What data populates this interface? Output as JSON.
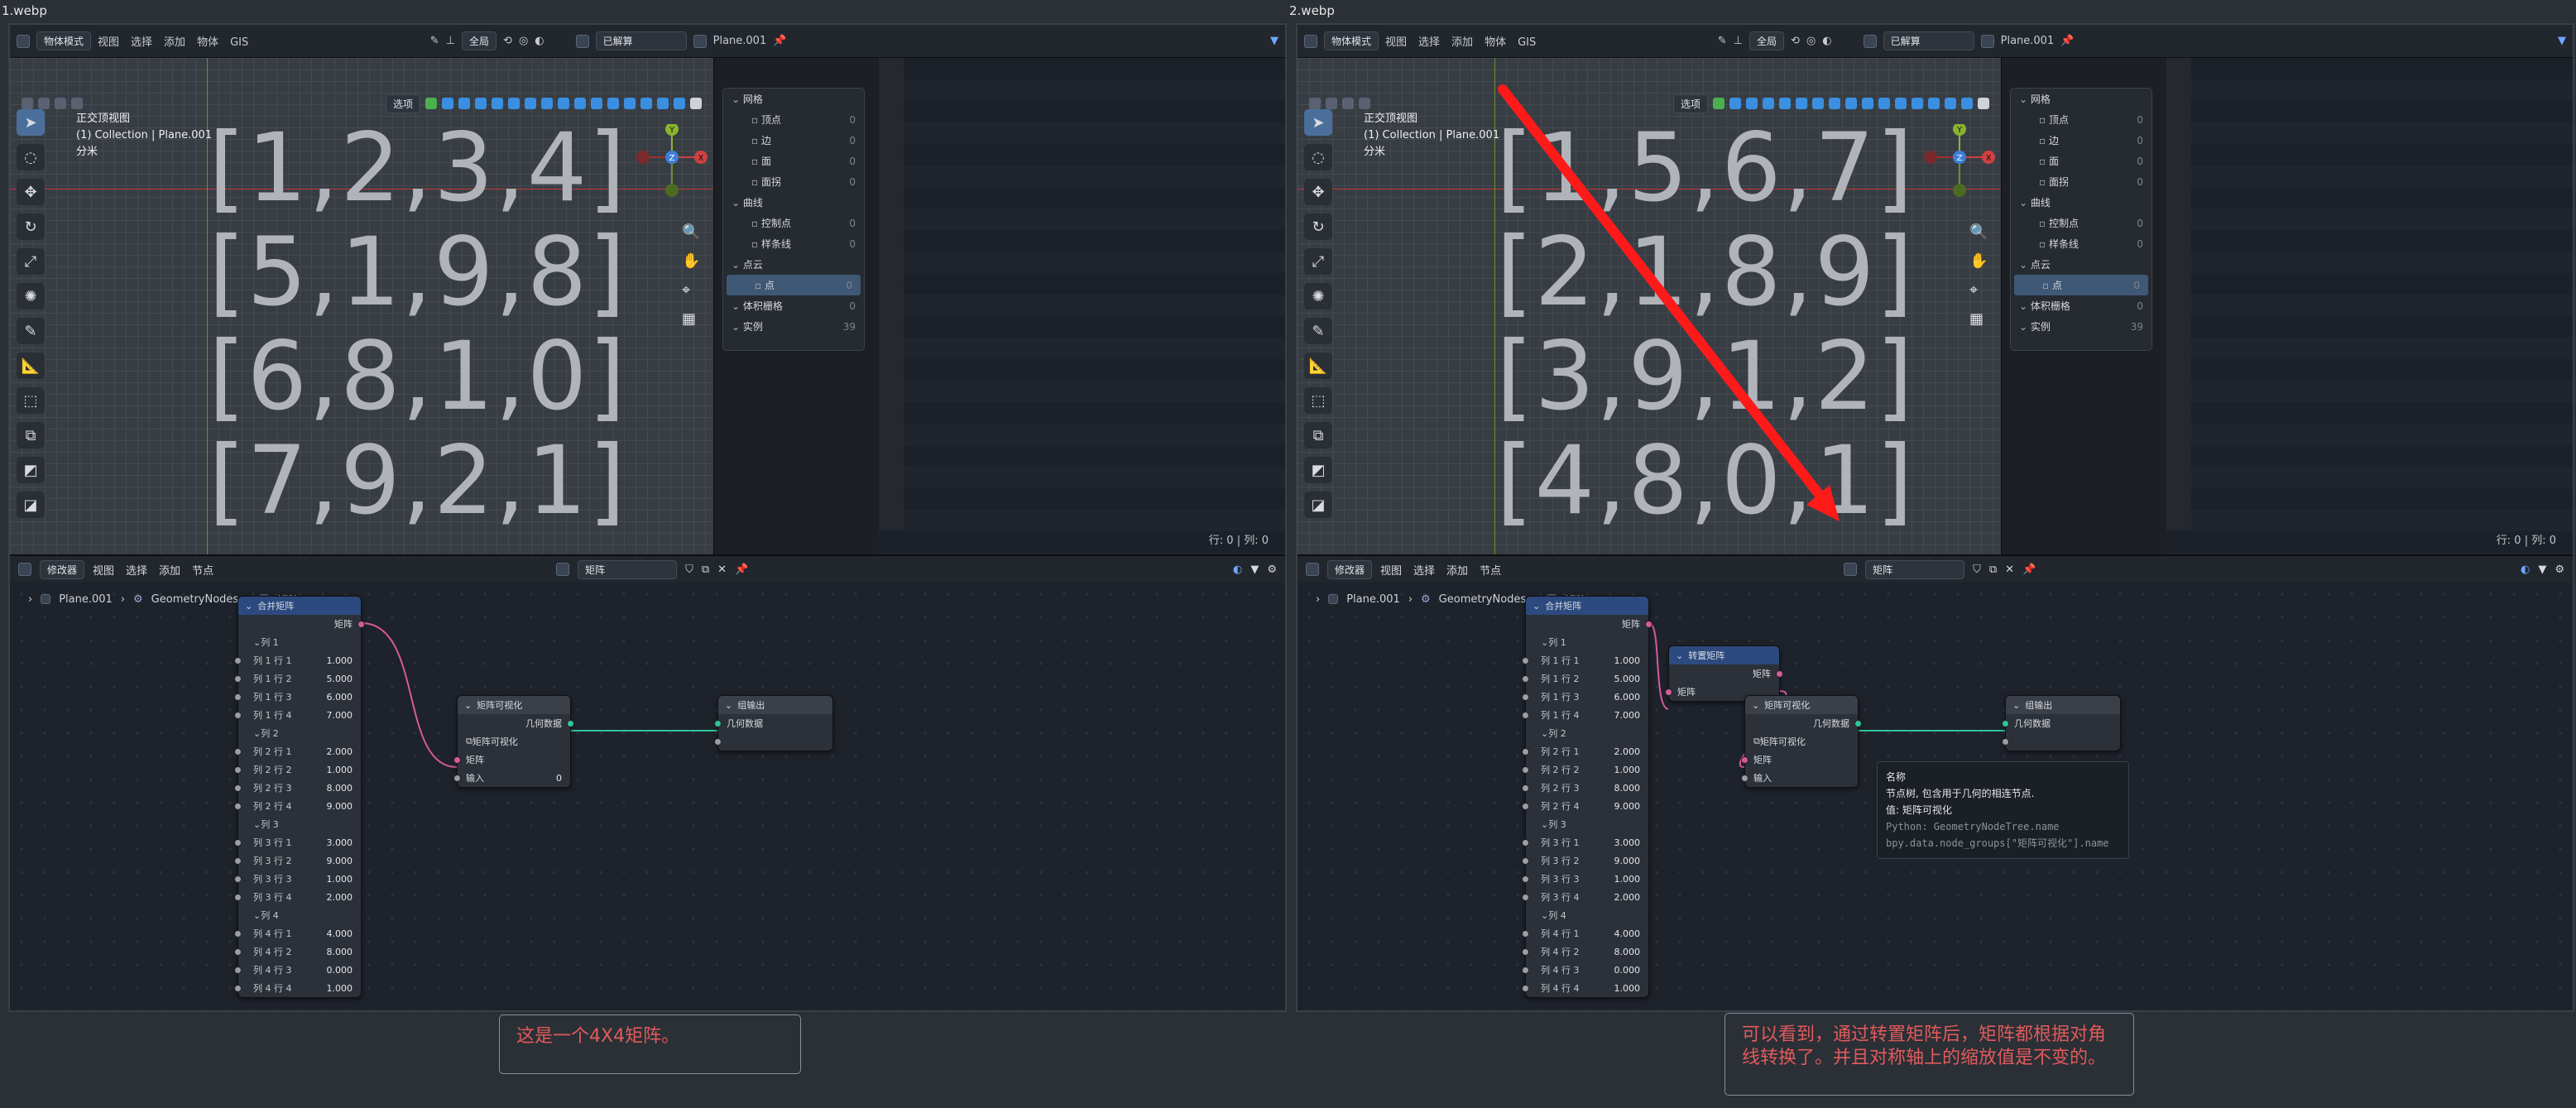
{
  "windows": [
    {
      "filename": "1.webp",
      "header": {
        "mode": "物体模式",
        "menus": [
          "视图",
          "选择",
          "添加",
          "物体",
          "GIS"
        ],
        "global": "全局",
        "evaluated": "已解算",
        "object": "Plane.001"
      },
      "overlay_options": "选项",
      "view_info": [
        "正交顶视图",
        "(1) Collection | Plane.001",
        "分米"
      ],
      "matrix": [
        "[1,2,3,4]",
        "[5,1,9,8]",
        "[6,8,1,0]",
        "[7,9,2,1]"
      ],
      "gizmo": {
        "x": "X",
        "y": "Y",
        "z": "Z"
      },
      "sidebar": {
        "items": [
          {
            "label": "网格",
            "value": "",
            "level": 0
          },
          {
            "label": "顶点",
            "value": "0",
            "level": 1
          },
          {
            "label": "边",
            "value": "0",
            "level": 1
          },
          {
            "label": "面",
            "value": "0",
            "level": 1
          },
          {
            "label": "面拐",
            "value": "0",
            "level": 1
          },
          {
            "label": "曲线",
            "value": "",
            "level": 0
          },
          {
            "label": "控制点",
            "value": "0",
            "level": 1
          },
          {
            "label": "样条线",
            "value": "0",
            "level": 1
          },
          {
            "label": "点云",
            "value": "",
            "level": 0
          },
          {
            "label": "点",
            "value": "0",
            "level": 1,
            "selected": true
          },
          {
            "label": "体积栅格",
            "value": "0",
            "level": 0
          },
          {
            "label": "实例",
            "value": "39",
            "level": 0
          }
        ]
      },
      "rowcol": "行: 0  |  列: 0",
      "node_header": {
        "editor": "修改器",
        "menus": [
          "视图",
          "选择",
          "添加",
          "节点"
        ],
        "tree": "矩阵"
      },
      "breadcrumb": [
        "Plane.001",
        "GeometryNodes",
        "矩阵"
      ],
      "combine": {
        "title": "合并矩阵",
        "output": "矩阵",
        "columns": [
          {
            "label": "列 1",
            "rows": [
              [
                "列 1 行 1",
                "1.000"
              ],
              [
                "列 1 行 2",
                "5.000"
              ],
              [
                "列 1 行 3",
                "6.000"
              ],
              [
                "列 1 行 4",
                "7.000"
              ]
            ]
          },
          {
            "label": "列 2",
            "rows": [
              [
                "列 2 行 1",
                "2.000"
              ],
              [
                "列 2 行 2",
                "1.000"
              ],
              [
                "列 2 行 3",
                "8.000"
              ],
              [
                "列 2 行 4",
                "9.000"
              ]
            ]
          },
          {
            "label": "列 3",
            "rows": [
              [
                "列 3 行 1",
                "3.000"
              ],
              [
                "列 3 行 2",
                "9.000"
              ],
              [
                "列 3 行 3",
                "1.000"
              ],
              [
                "列 3 行 4",
                "2.000"
              ]
            ]
          },
          {
            "label": "列 4",
            "rows": [
              [
                "列 4 行 1",
                "4.000"
              ],
              [
                "列 4 行 2",
                "8.000"
              ],
              [
                "列 4 行 3",
                "0.000"
              ],
              [
                "列 4 行 4",
                "1.000"
              ]
            ]
          }
        ]
      },
      "viz": {
        "title": "矩阵可视化",
        "output": "几何数据",
        "group": "矩阵可视化",
        "input1": "矩阵",
        "input2": "输入",
        "input2_value": "0"
      },
      "out": {
        "title": "组输出",
        "input": "几何数据"
      },
      "note": "这是一个4X4矩阵。"
    },
    {
      "filename": "2.webp",
      "header": {
        "mode": "物体模式",
        "menus": [
          "视图",
          "选择",
          "添加",
          "物体",
          "GIS"
        ],
        "global": "全局",
        "evaluated": "已解算",
        "object": "Plane.001"
      },
      "overlay_options": "选项",
      "view_info": [
        "正交顶视图",
        "(1) Collection | Plane.001",
        "分米"
      ],
      "matrix": [
        "[1,5,6,7]",
        "[2,1,8,9]",
        "[3,9,1,2]",
        "[4,8,0,1]"
      ],
      "gizmo": {
        "x": "X",
        "y": "Y",
        "z": "Z"
      },
      "sidebar": {
        "items": [
          {
            "label": "网格",
            "value": "",
            "level": 0
          },
          {
            "label": "顶点",
            "value": "0",
            "level": 1
          },
          {
            "label": "边",
            "value": "0",
            "level": 1
          },
          {
            "label": "面",
            "value": "0",
            "level": 1
          },
          {
            "label": "面拐",
            "value": "0",
            "level": 1
          },
          {
            "label": "曲线",
            "value": "",
            "level": 0
          },
          {
            "label": "控制点",
            "value": "0",
            "level": 1
          },
          {
            "label": "样条线",
            "value": "0",
            "level": 1
          },
          {
            "label": "点云",
            "value": "",
            "level": 0
          },
          {
            "label": "点",
            "value": "0",
            "level": 1,
            "selected": true
          },
          {
            "label": "体积栅格",
            "value": "0",
            "level": 0
          },
          {
            "label": "实例",
            "value": "39",
            "level": 0
          }
        ]
      },
      "rowcol": "行: 0  |  列: 0",
      "node_header": {
        "editor": "修改器",
        "menus": [
          "视图",
          "选择",
          "添加",
          "节点"
        ],
        "tree": "矩阵"
      },
      "breadcrumb": [
        "Plane.001",
        "GeometryNodes",
        "矩阵"
      ],
      "combine": {
        "title": "合并矩阵",
        "output": "矩阵",
        "columns": [
          {
            "label": "列 1",
            "rows": [
              [
                "列 1 行 1",
                "1.000"
              ],
              [
                "列 1 行 2",
                "5.000"
              ],
              [
                "列 1 行 3",
                "6.000"
              ],
              [
                "列 1 行 4",
                "7.000"
              ]
            ]
          },
          {
            "label": "列 2",
            "rows": [
              [
                "列 2 行 1",
                "2.000"
              ],
              [
                "列 2 行 2",
                "1.000"
              ],
              [
                "列 2 行 3",
                "8.000"
              ],
              [
                "列 2 行 4",
                "9.000"
              ]
            ]
          },
          {
            "label": "列 3",
            "rows": [
              [
                "列 3 行 1",
                "3.000"
              ],
              [
                "列 3 行 2",
                "9.000"
              ],
              [
                "列 3 行 3",
                "1.000"
              ],
              [
                "列 3 行 4",
                "2.000"
              ]
            ]
          },
          {
            "label": "列 4",
            "rows": [
              [
                "列 4 行 1",
                "4.000"
              ],
              [
                "列 4 行 2",
                "8.000"
              ],
              [
                "列 4 行 3",
                "0.000"
              ],
              [
                "列 4 行 4",
                "1.000"
              ]
            ]
          }
        ]
      },
      "transpose": {
        "title": "转置矩阵",
        "output": "矩阵",
        "input": "矩阵"
      },
      "viz": {
        "title": "矩阵可视化",
        "output": "几何数据",
        "group": "矩阵可视化",
        "input1": "矩阵",
        "input2": "输入",
        "input2_value": ""
      },
      "out": {
        "title": "组输出",
        "input": "几何数据"
      },
      "tooltip": {
        "title": "名称",
        "desc": "节点树, 包含用于几何的相连节点.",
        "value": "值: 矩阵可视化",
        "py1": "Python: GeometryNodeTree.name",
        "py2": "bpy.data.node_groups[\"矩阵可视化\"].name"
      },
      "note": "可以看到，通过转置矩阵后，矩阵都根据对角线转换了。并且对称轴上的缩放值是不变的。"
    }
  ],
  "colors": {
    "accent": "#4a6f9a",
    "arrow": "#ff1a1a",
    "note_text": "#e05b5b",
    "wire_matrix": "#d65a9a",
    "wire_geo": "#2fc59a"
  }
}
